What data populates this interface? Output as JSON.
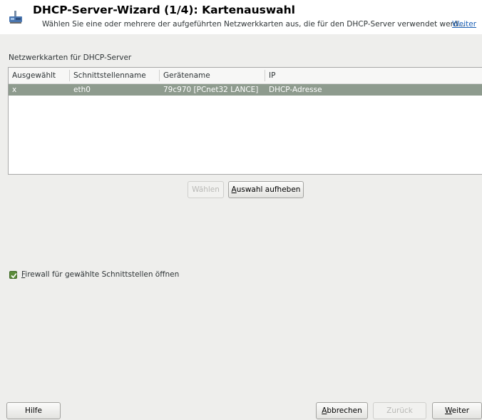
{
  "header": {
    "title": "DHCP-Server-Wizard (1/4): Kartenauswahl",
    "subtitle": "Wählen Sie eine oder mehrere der aufgeführten Netzwerkkarten aus, die für den DHCP-Server verwendet werd...",
    "more_link": "Weiter",
    "icon": "network-card-icon"
  },
  "section_label": "Netzwerkkarten für DHCP-Server",
  "table": {
    "columns": [
      "Ausgewählt",
      "Schnittstellenname",
      "Gerätename",
      "IP"
    ],
    "rows": [
      [
        "x",
        "eth0",
        "79c970 [PCnet32 LANCE]",
        "DHCP-Adresse"
      ]
    ],
    "selected_row_color": "#8e9b8e"
  },
  "buttons": {
    "select": "Wählen",
    "deselect_mnemonic": "A",
    "deselect_rest": "uswahl aufheben",
    "help": "Hilfe",
    "abort_mnemonic": "A",
    "abort_rest": "bbrechen",
    "back": "Zurück",
    "next_mnemonic": "W",
    "next_rest": "eiter"
  },
  "firewall": {
    "mnemonic": "F",
    "label_rest": "irewall für gewählte Schnittstellen öffnen",
    "checked": true
  }
}
